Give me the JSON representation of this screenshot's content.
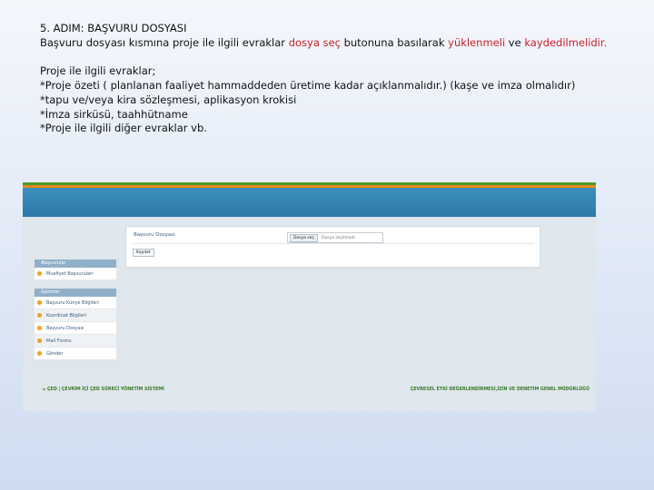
{
  "instructions": {
    "heading": "5. ADIM: BAŞVURU DOSYASI",
    "line1_part1": "Başvuru dosyası kısmına proje ile ilgili evraklar ",
    "line1_red1": "dosya seç",
    "line1_part2": " butonuna basılarak ",
    "line1_red2": "yüklenmeli",
    "line1_part3": " ve ",
    "line1_red3": "kaydedilmelidir.",
    "list_title": "Proje ile ilgili evraklar;",
    "items": [
      "*Proje özeti ( planlanan faaliyet hammaddeden üretime kadar açıklanmalıdır.) (kaşe ve imza olmalıdır)",
      "*tapu ve/veya kira sözleşmesi, aplikasyon krokisi",
      "*İmza sirküsü, taahhütname",
      "*Proje ile ilgili diğer evraklar vb."
    ]
  },
  "screenshot": {
    "colors": {
      "green": "#4f9a2c",
      "orange": "#e88a1c",
      "topbar": "#2d78a8"
    },
    "sidebar": {
      "section1_title": "-Başvurular",
      "section1_items": [
        "Muafiyet Başvuruları"
      ],
      "section2_title": "-İşlemler",
      "section2_items": [
        "Başvuru Künye Bilgileri",
        "Koordinat Bilgileri",
        "Başvuru Dosyası",
        "Mail Formu",
        "Gönder"
      ]
    },
    "panel": {
      "title": "Başvuru Dosyası",
      "choose_button": "Dosya seç",
      "file_status": "Dosya seçilmedi",
      "save_button": "Kaydet"
    },
    "footer": {
      "left": "ÇED | ÇEVRİM İÇİ ÇED SÜRECİ YÖNETİM SİSTEMİ",
      "right": "ÇEVRESEL ETKİ DEĞERLENDİRMESİ,İZİN VE DENETİM GENEL MÜDÜRLÜĞÜ",
      "leaf_icon": "leaf-icon"
    }
  }
}
